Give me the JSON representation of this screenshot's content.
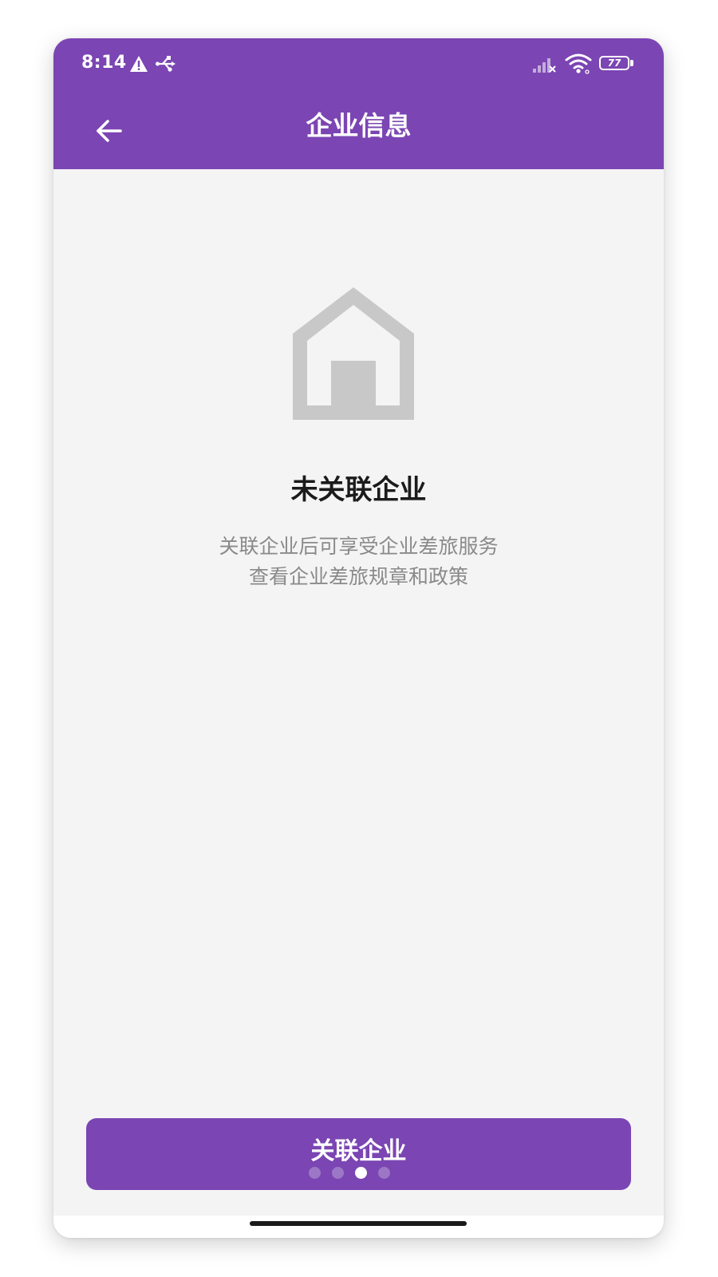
{
  "status_bar": {
    "time": "8:14",
    "battery_level": "77",
    "icons": [
      "warning-icon",
      "usb-icon",
      "signal-icon",
      "wifi-icon",
      "battery-icon"
    ]
  },
  "navbar": {
    "back_icon": "arrow-left-icon",
    "title": "企业信息"
  },
  "empty_state": {
    "icon": "house-icon",
    "title": "未关联企业",
    "desc_line1": "关联企业后可享受企业差旅服务",
    "desc_line2": "查看企业差旅规章和政策"
  },
  "primary_button": {
    "label": "关联企业"
  },
  "page_indicator": {
    "count": 4,
    "active_index": 2
  },
  "colors": {
    "brand": "#7b45b3",
    "background": "#f4f4f5",
    "icon_gray": "#c8c8c8",
    "title_text": "#1b1b1b",
    "desc_text": "#8a8a8a"
  }
}
